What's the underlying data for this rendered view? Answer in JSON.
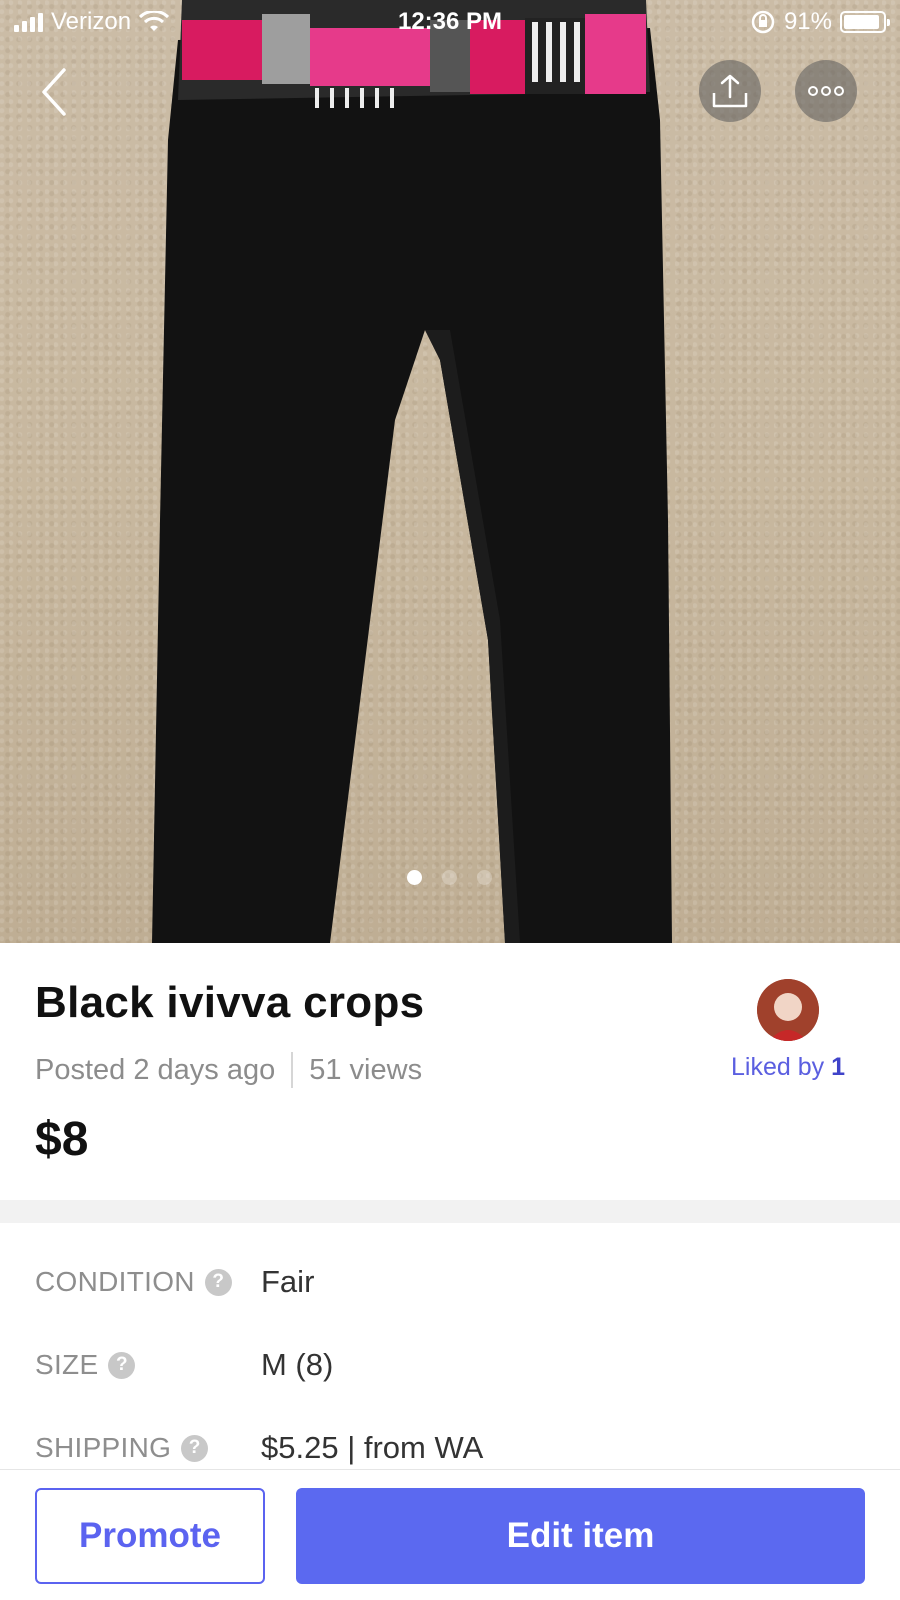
{
  "status_bar": {
    "carrier": "Verizon",
    "time": "12:36 PM",
    "battery": "91%",
    "battery_level": 0.91
  },
  "photo": {
    "alt_subject": "black cropped leggings with pink and striped waistband on carpet",
    "page_count": 3,
    "active_page": 1
  },
  "toolbar": {
    "back_icon": "chevron-left-icon",
    "share_icon": "share-upload-icon",
    "more_icon": "more-dots-icon"
  },
  "listing": {
    "title": "Black ivivva crops",
    "posted": "Posted 2 days ago",
    "views": "51 views",
    "price": "$8",
    "liked_by_label": "Liked by",
    "liked_by_count": "1"
  },
  "details": [
    {
      "label": "CONDITION",
      "value": "Fair"
    },
    {
      "label": "SIZE",
      "value": "M (8)"
    },
    {
      "label": "SHIPPING",
      "value": "$5.25 | from WA"
    }
  ],
  "actions": {
    "promote_label": "Promote",
    "edit_label": "Edit item"
  },
  "colors": {
    "accent": "#5b69f0",
    "liked_text": "#5b5fe0"
  }
}
